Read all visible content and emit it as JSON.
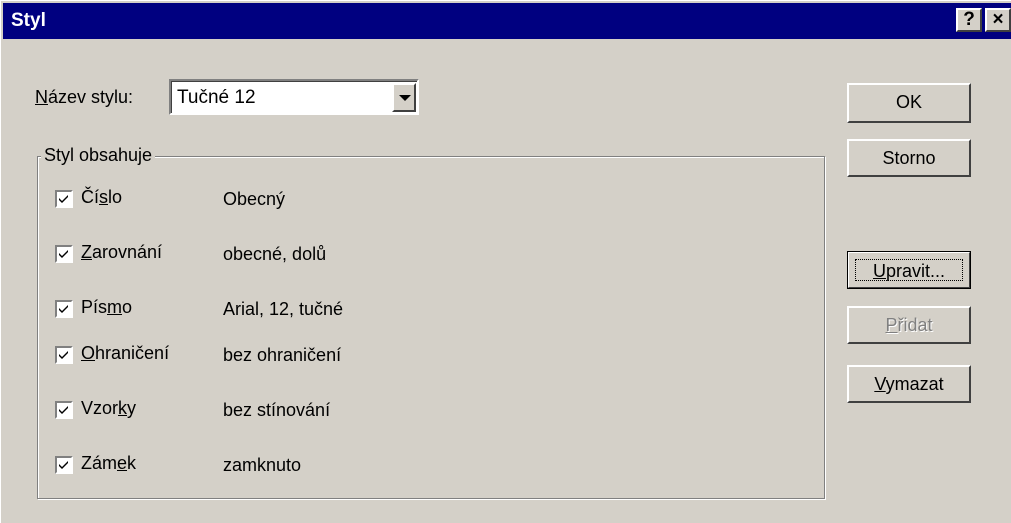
{
  "window": {
    "title": "Styl",
    "help_label": "?",
    "close_label": "×"
  },
  "style_name": {
    "label_mnemonic": "N",
    "label_rest": "ázev stylu:",
    "value": "Tučné 12"
  },
  "group": {
    "title": "Styl obsahuje",
    "items": [
      {
        "label_pre": "Čí",
        "mnemonic": "s",
        "label_post": "lo",
        "value": "Obecný",
        "checked": true
      },
      {
        "label_pre": "",
        "mnemonic": "Z",
        "label_post": "arovnání",
        "value": "obecné, dolů",
        "checked": true
      },
      {
        "label_pre": "Pís",
        "mnemonic": "m",
        "label_post": "o",
        "value": "Arial, 12, tučné",
        "checked": true
      },
      {
        "label_pre": "",
        "mnemonic": "O",
        "label_post": "hraničení",
        "value": "bez ohraničení",
        "checked": true
      },
      {
        "label_pre": "Vzor",
        "mnemonic": "k",
        "label_post": "y",
        "value": "bez stínování",
        "checked": true
      },
      {
        "label_pre": "Zám",
        "mnemonic": "e",
        "label_post": "k",
        "value": "zamknuto",
        "checked": true
      }
    ]
  },
  "buttons": {
    "ok": "OK",
    "storno": "Storno",
    "upravit_mnemonic": "U",
    "upravit_rest": "pravit...",
    "pridat_mnemonic": "P",
    "pridat_rest": "řidat",
    "vymazat_mnemonic": "V",
    "vymazat_rest": "ymazat"
  },
  "colors": {
    "titlebar": "#000080",
    "face": "#d4d0c8",
    "disabled_text": "#808080"
  }
}
